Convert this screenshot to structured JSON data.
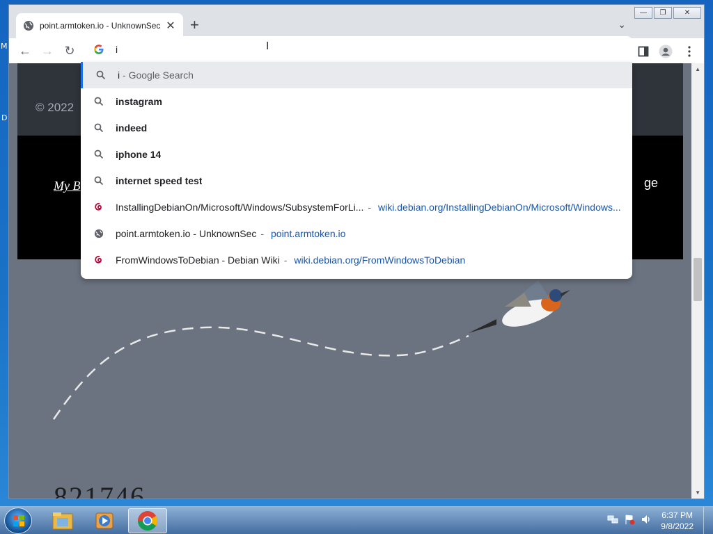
{
  "desktop": {
    "frag1": "M",
    "frag2": "D"
  },
  "window": {
    "tab_title": "point.armtoken.io - UnknownSec",
    "tab_close": "✕",
    "new_tab": "+",
    "tab_list": "⌄",
    "caption": {
      "minimize": "—",
      "maximize": "❐",
      "close": "✕"
    }
  },
  "toolbar": {
    "back": "←",
    "forward": "→",
    "reload": "↻"
  },
  "omnibox": {
    "value": "i"
  },
  "suggestions": [
    {
      "kind": "search",
      "bold": "",
      "rest": "i",
      "suffix": " - Google Search",
      "selected": true
    },
    {
      "kind": "search",
      "bold": "instagram",
      "rest": "",
      "suffix": ""
    },
    {
      "kind": "search",
      "bold": "indeed",
      "rest": "",
      "suffix": ""
    },
    {
      "kind": "search",
      "bold": "iphone 14",
      "rest": "",
      "suffix": ""
    },
    {
      "kind": "search",
      "bold": "internet speed test",
      "rest": "",
      "suffix": ""
    },
    {
      "kind": "debian",
      "title": "InstallingDebianOn/Microsoft/Windows/SubsystemForLi...",
      "url": "wiki.debian.org/InstallingDebianOn/Microsoft/Windows..."
    },
    {
      "kind": "globe",
      "title": "point.armtoken.io - UnknownSec",
      "url": "point.armtoken.io"
    },
    {
      "kind": "debian",
      "title": "FromWindowsToDebian - Debian Wiki",
      "url": "wiki.debian.org/FromWindowsToDebian"
    }
  ],
  "page": {
    "copyright": "© 2022",
    "link_fragment": "My B",
    "right_fragment": "ge",
    "big_number": "821746"
  },
  "taskbar": {
    "time": "6:37 PM",
    "date": "9/8/2022"
  },
  "colors": {
    "accent": "#1a73e8",
    "url": "#1a55a8",
    "page_bg": "#6b7380"
  }
}
